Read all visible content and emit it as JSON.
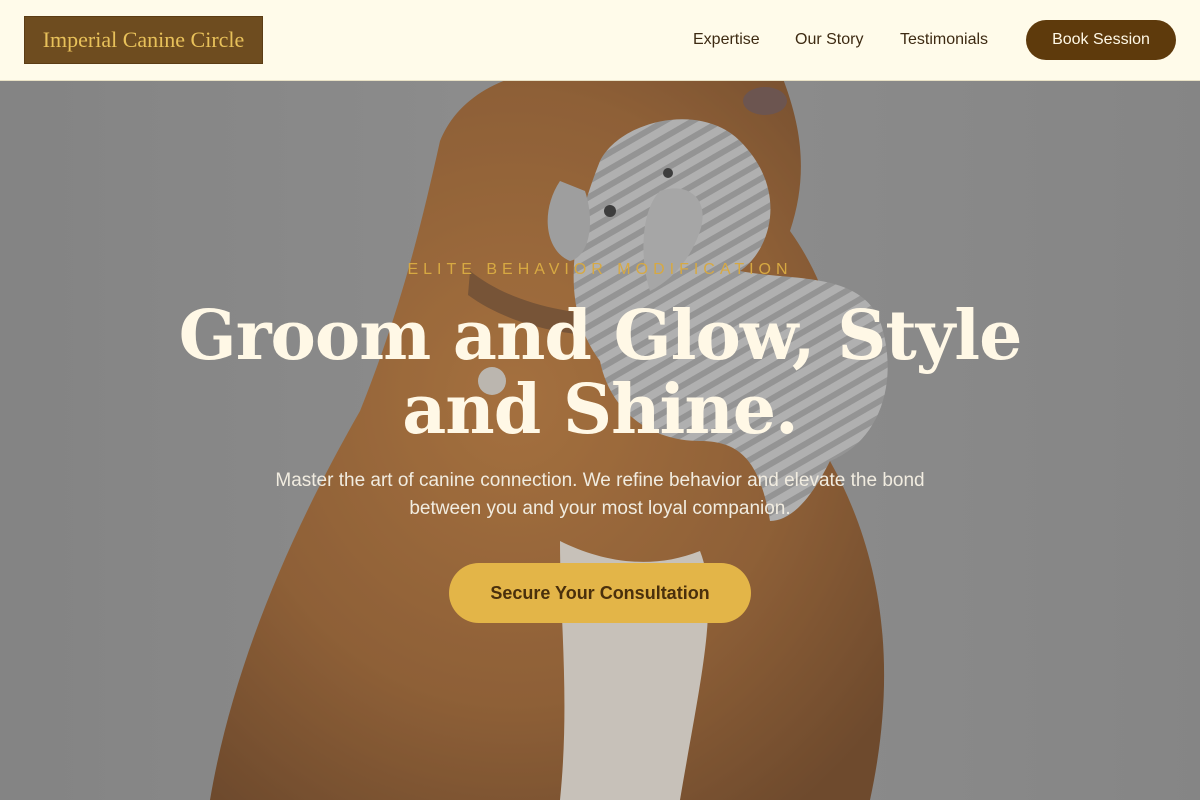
{
  "header": {
    "logo_text": "Imperial Canine Circle",
    "nav": {
      "expertise": "Expertise",
      "our_story": "Our Story",
      "testimonials": "Testimonials"
    },
    "book_button": "Book Session"
  },
  "hero": {
    "eyebrow": "ELITE BEHAVIOR MODIFICATION",
    "headline": "Groom and Glow, Style and Shine.",
    "subtext": "Master the art of canine connection. We refine behavior and elevate the bond between you and your most loyal companion.",
    "cta_button": "Secure Your Consultation",
    "image": "dog-holding-plush-elephant-toy"
  },
  "colors": {
    "header_bg": "#fffbea",
    "logo_bg": "#6e4c1f",
    "logo_text": "#e8c15a",
    "nav_text": "#3d2a12",
    "book_button_bg": "#5e3a0c",
    "eyebrow": "#d7a942",
    "headline": "#fff8e6",
    "cta_bg": "#e3b548",
    "cta_text": "#4a300c"
  }
}
